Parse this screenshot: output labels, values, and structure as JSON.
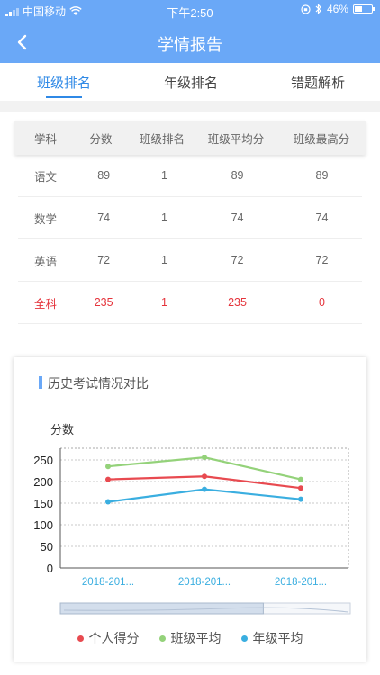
{
  "status": {
    "carrier": "中国移动",
    "time": "下午2:50",
    "battery": "46%",
    "battery_level": 0.46
  },
  "header": {
    "title": "学情报告"
  },
  "tabs": [
    {
      "label": "班级排名",
      "active": true
    },
    {
      "label": "年级排名",
      "active": false
    },
    {
      "label": "错题解析",
      "active": false
    }
  ],
  "table": {
    "headers": [
      "学科",
      "分数",
      "班级排名",
      "班级平均分",
      "班级最高分"
    ],
    "rows": [
      [
        "语文",
        "89",
        "1",
        "89",
        "89"
      ],
      [
        "数学",
        "74",
        "1",
        "74",
        "74"
      ],
      [
        "英语",
        "72",
        "1",
        "72",
        "72"
      ],
      [
        "全科",
        "235",
        "1",
        "235",
        "0"
      ]
    ]
  },
  "chart_section": {
    "title": "历史考试情况对比"
  },
  "colors": {
    "accent": "#2f89e6",
    "header": "#6aa8f7",
    "personal": "#e84a50",
    "class_avg": "#94d27a",
    "grade_avg": "#3aaee0"
  },
  "chart_data": {
    "type": "line",
    "ylabel": "分数",
    "ylim": [
      0,
      250
    ],
    "yticks": [
      0,
      50,
      100,
      150,
      200,
      250
    ],
    "categories": [
      "2018-201...",
      "2018-201...",
      "2018-201..."
    ],
    "series": [
      {
        "name": "个人得分",
        "color": "#e84a50",
        "values": [
          205,
          212,
          185
        ]
      },
      {
        "name": "班级平均",
        "color": "#94d27a",
        "values": [
          235,
          256,
          205
        ]
      },
      {
        "name": "年级平均",
        "color": "#3aaee0",
        "values": [
          153,
          182,
          159
        ]
      }
    ],
    "grid": true,
    "legend": "bottom",
    "zoom_window": [
      0,
      0.7
    ]
  }
}
